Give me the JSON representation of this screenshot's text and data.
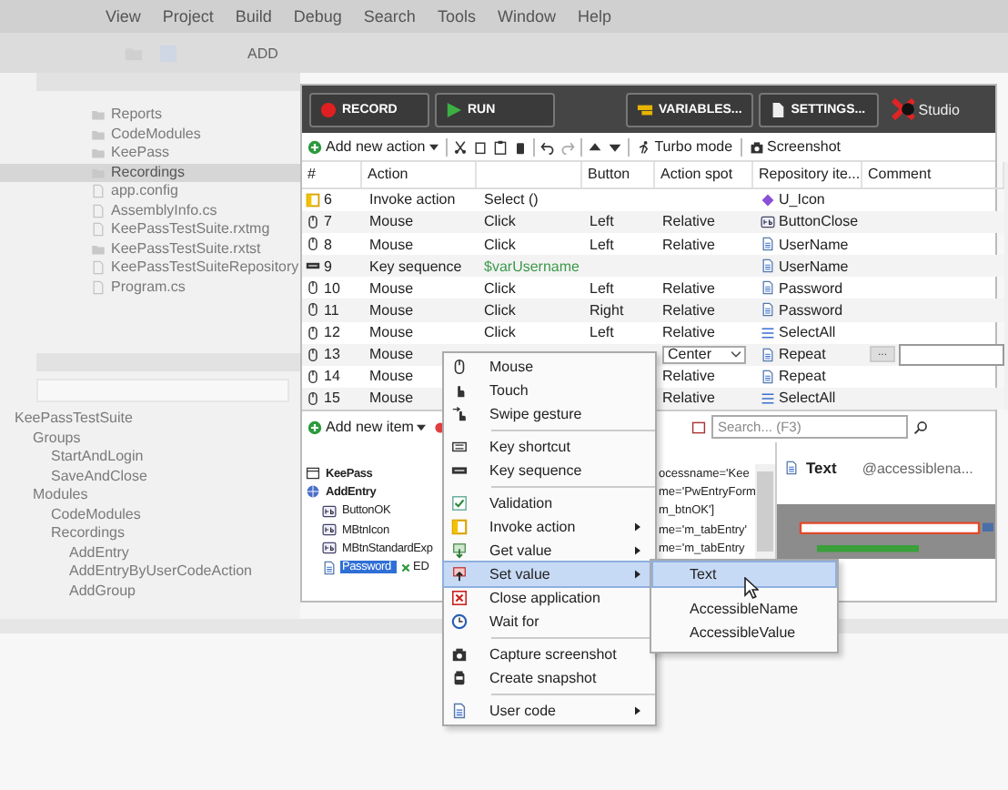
{
  "ide": {
    "menu": [
      "View",
      "Project",
      "Build",
      "Debug",
      "Search",
      "Tools",
      "Window",
      "Help"
    ],
    "toolbar_text": "ADD"
  },
  "solution_explorer": {
    "items": [
      {
        "label": "Reports",
        "kind": "folder",
        "selected": false
      },
      {
        "label": "CodeModules",
        "kind": "folder",
        "selected": false
      },
      {
        "label": "KeePass",
        "kind": "folder",
        "selected": false
      },
      {
        "label": "Recordings",
        "kind": "folder",
        "selected": true
      },
      {
        "label": "app.config",
        "kind": "file",
        "selected": false
      },
      {
        "label": "AssemblyInfo.cs",
        "kind": "file",
        "selected": false
      },
      {
        "label": "KeePassTestSuite.rxtmg",
        "kind": "file",
        "selected": false
      },
      {
        "label": "KeePassTestSuite.rxtst",
        "kind": "folder",
        "selected": false
      },
      {
        "label": "KeePassTestSuiteRepository",
        "kind": "file",
        "selected": false
      },
      {
        "label": "Program.cs",
        "kind": "file",
        "selected": false
      }
    ]
  },
  "suite_browser": {
    "tree": [
      {
        "label": "KeePassTestSuite",
        "children": [
          {
            "label": "Groups",
            "children": [
              {
                "label": "StartAndLogin"
              },
              {
                "label": "SaveAndClose"
              }
            ]
          },
          {
            "label": "Modules",
            "children": [
              {
                "label": "CodeModules"
              },
              {
                "label": "Recordings",
                "children": [
                  {
                    "label": "AddEntry"
                  },
                  {
                    "label": "AddEntryByUserCodeAction"
                  },
                  {
                    "label": "AddGroup"
                  }
                ]
              }
            ]
          }
        ]
      }
    ]
  },
  "recorder": {
    "toolbar": [
      {
        "label": "RECORD",
        "kind": "record"
      },
      {
        "label": "RUN",
        "kind": "run"
      },
      {
        "label": "VARIABLES...",
        "kind": "variables"
      },
      {
        "label": "SETTINGS...",
        "kind": "settings"
      }
    ],
    "logo_text": "Studio",
    "action_toolbar": {
      "add_label": "Add new action",
      "turbo_label": "Turbo mode",
      "screenshot_label": "Screenshot"
    },
    "table": {
      "columns": [
        "#",
        "Action",
        "Button",
        "Action spot",
        "Repository ite...",
        "Comment"
      ],
      "rows": [
        {
          "num": "6",
          "kind": "invoke",
          "action": "Invoke action",
          "value": "Select ()",
          "repo": {
            "text": "U_Icon",
            "kind": "tag"
          },
          "editing": false
        },
        {
          "num": "7",
          "kind": "mouse",
          "action": "Mouse",
          "value": "Click",
          "button": "Left",
          "spot": "Relative",
          "repo": {
            "text": "ButtonClose",
            "kind": "button"
          },
          "editing": false
        },
        {
          "num": "8",
          "kind": "mouse",
          "action": "Mouse",
          "value": "Click",
          "button": "Left",
          "spot": "Relative",
          "repo": {
            "text": "UserName",
            "kind": "text"
          },
          "editing": false
        },
        {
          "num": "9",
          "kind": "key",
          "action": "Key sequence",
          "value": "$varUsername",
          "value_is_variable": true,
          "repo": {
            "text": "UserName",
            "kind": "text"
          },
          "editing": false
        },
        {
          "num": "10",
          "kind": "mouse",
          "action": "Mouse",
          "value": "Click",
          "button": "Left",
          "spot": "Relative",
          "repo": {
            "text": "Password",
            "kind": "text"
          },
          "editing": false
        },
        {
          "num": "11",
          "kind": "mouse",
          "action": "Mouse",
          "value": "Click",
          "button": "Right",
          "spot": "Relative",
          "repo": {
            "text": "Password",
            "kind": "text"
          },
          "editing": false
        },
        {
          "num": "12",
          "kind": "mouse",
          "action": "Mouse",
          "value": "Click",
          "button": "Left",
          "spot": "Relative",
          "repo": {
            "text": "SelectAll",
            "kind": "list"
          },
          "editing": false
        },
        {
          "num": "13",
          "kind": "mouse",
          "action": "Mouse",
          "spot": "Center",
          "repo": {
            "text": "Repeat",
            "kind": "text"
          },
          "editing": true,
          "more_label": "..."
        },
        {
          "num": "14",
          "kind": "mouse",
          "action": "Mouse",
          "spot": "Relative",
          "repo": {
            "text": "Repeat",
            "kind": "text"
          },
          "editing": false
        },
        {
          "num": "15",
          "kind": "mouse",
          "action": "Mouse",
          "spot": "Relative",
          "repo": {
            "text": "SelectAll",
            "kind": "list"
          },
          "editing": false
        }
      ]
    },
    "repository": {
      "add_label": "Add new item",
      "search_placeholder": "Search... (F3)",
      "tree": [
        {
          "label": "KeePass",
          "kind": "app",
          "path": "ocessname='Kee",
          "selected": false,
          "children": [
            {
              "label": "AddEntry",
              "kind": "form",
              "path": "me='PwEntryForm",
              "selected": false,
              "children": [
                {
                  "label": "ButtonOK",
                  "kind": "button",
                  "path": "m_btnOK']",
                  "selected": false
                },
                {
                  "label": "MBtnIcon",
                  "kind": "button",
                  "path": "me='m_tabEntry'",
                  "selected": false
                },
                {
                  "label": "MBtnStandardExp",
                  "kind": "button",
                  "path": "me='m_tabEntry",
                  "selected": false
                },
                {
                  "label": "Password",
                  "kind": "text",
                  "badge": "ED",
                  "selected": true
                }
              ]
            }
          ]
        }
      ],
      "preview": {
        "title": "Text",
        "attribute": "@accessiblena..."
      }
    },
    "context_menu": {
      "items": [
        {
          "label": "Mouse",
          "kind": "mouse",
          "has_submenu": false,
          "selected": false
        },
        {
          "label": "Touch",
          "kind": "hand",
          "has_submenu": false,
          "selected": false
        },
        {
          "label": "Swipe gesture",
          "kind": "swipe",
          "has_submenu": false,
          "selected": false
        },
        {
          "kind": "separator"
        },
        {
          "label": "Key shortcut",
          "kind": "keyboard",
          "has_submenu": false,
          "selected": false
        },
        {
          "label": "Key sequence",
          "kind": "keys",
          "has_submenu": false,
          "selected": false
        },
        {
          "kind": "separator"
        },
        {
          "label": "Validation",
          "kind": "check",
          "has_submenu": false,
          "selected": false
        },
        {
          "label": "Invoke action",
          "kind": "window",
          "has_submenu": true,
          "selected": false
        },
        {
          "label": "Get value",
          "kind": "down",
          "has_submenu": true,
          "selected": false
        },
        {
          "label": "Set value",
          "kind": "up",
          "has_submenu": true,
          "selected": true
        },
        {
          "label": "Close application",
          "kind": "close",
          "has_submenu": false,
          "selected": false
        },
        {
          "label": "Wait for",
          "kind": "clock",
          "has_submenu": false,
          "selected": false
        },
        {
          "kind": "separator"
        },
        {
          "label": "Capture screenshot",
          "kind": "camera",
          "has_submenu": false,
          "selected": false
        },
        {
          "label": "Create snapshot",
          "kind": "jar",
          "has_submenu": false,
          "selected": false
        },
        {
          "kind": "separator"
        },
        {
          "label": "User code",
          "kind": "doc",
          "has_submenu": true,
          "selected": false
        }
      ]
    },
    "submenu": {
      "items": [
        {
          "label": "Text",
          "selected": true
        },
        {
          "label": "AccessibleName",
          "selected": false
        },
        {
          "label": "AccessibleValue",
          "selected": false
        }
      ]
    }
  }
}
